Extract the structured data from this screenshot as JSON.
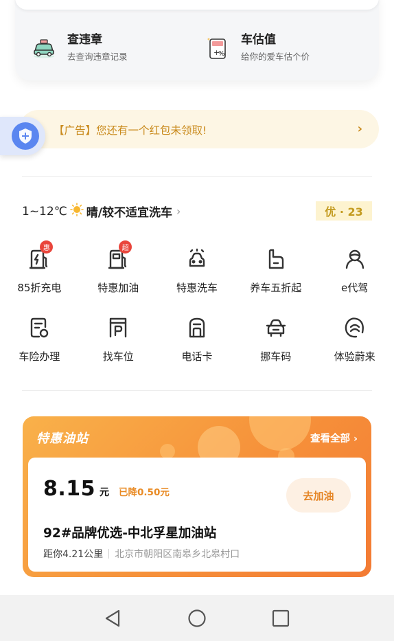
{
  "quick_tools": [
    {
      "title": "查违章",
      "subtitle": "去查询违章记录",
      "icon": "car-check-icon"
    },
    {
      "title": "车估值",
      "subtitle": "给你的爱车估个价",
      "icon": "calculator-icon"
    }
  ],
  "ad": {
    "text": "【广告】您还有一个红包未领取!",
    "chevron": "›"
  },
  "weather": {
    "temp": "1~12℃",
    "desc": "晴/较不适宜洗车",
    "chev": "›",
    "aqi": "优 · 23",
    "icon": "sun-icon"
  },
  "services": [
    [
      {
        "label": "85折充电",
        "icon": "charging-icon",
        "badge": "惠"
      },
      {
        "label": "特惠加油",
        "icon": "fuel-icon",
        "badge": "超"
      },
      {
        "label": "特惠洗车",
        "icon": "car-wash-icon"
      },
      {
        "label": "养车五折起",
        "icon": "maintenance-icon"
      },
      {
        "label": "e代驾",
        "icon": "driver-icon"
      }
    ],
    [
      {
        "label": "车险办理",
        "icon": "insurance-icon"
      },
      {
        "label": "找车位",
        "icon": "parking-icon"
      },
      {
        "label": "电话卡",
        "icon": "sim-card-icon"
      },
      {
        "label": "挪车码",
        "icon": "move-car-icon"
      },
      {
        "label": "体验蔚来",
        "icon": "nio-icon"
      }
    ]
  ],
  "station": {
    "section_title": "特惠油站",
    "view_all": "查看全部 ›",
    "price": "8.15",
    "unit": "元",
    "drop": "已降0.50元",
    "go_button": "去加油",
    "name": "92#品牌优选-中北孚星加油站",
    "distance": "距你4.21公里",
    "address": "北京市朝阳区南皋乡北皋村口"
  },
  "colors": {
    "accent": "#f6913a",
    "ad_text": "#c98a1c",
    "badge": "#e9453b"
  }
}
